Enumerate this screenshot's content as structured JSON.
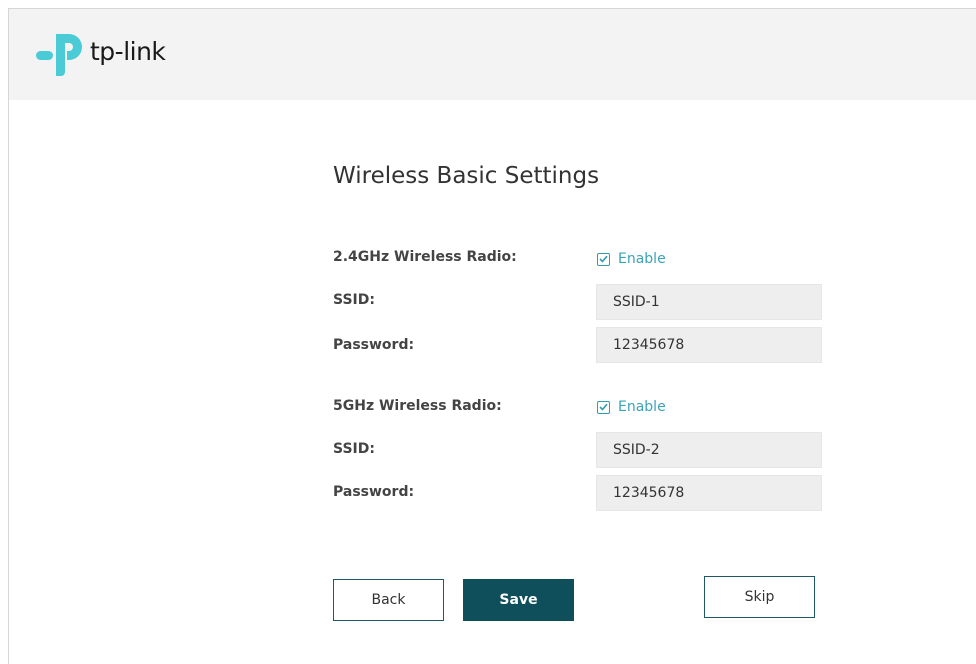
{
  "brand": {
    "name": "tp-link",
    "color": "#4acbd6"
  },
  "page": {
    "title": "Wireless Basic Settings"
  },
  "radio_24": {
    "label": "2.4GHz Wireless Radio:",
    "enable_label": "Enable",
    "enabled": true,
    "ssid_label": "SSID:",
    "ssid_value": "SSID-1",
    "password_label": "Password:",
    "password_value": "12345678"
  },
  "radio_5": {
    "label": "5GHz Wireless Radio:",
    "enable_label": "Enable",
    "enabled": true,
    "ssid_label": "SSID:",
    "ssid_value": "SSID-2",
    "password_label": "Password:",
    "password_value": "12345678"
  },
  "buttons": {
    "back": "Back",
    "save": "Save",
    "skip": "Skip"
  },
  "colors": {
    "primary": "#0f4f5c",
    "accent": "#3aa3b8",
    "field_bg": "#eeeeee",
    "header_bg": "#f3f3f3"
  }
}
